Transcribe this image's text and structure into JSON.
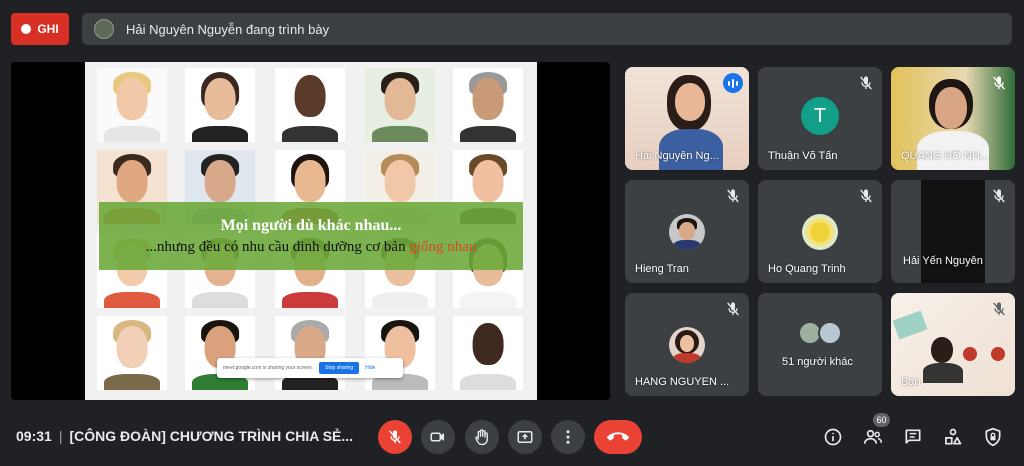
{
  "top_bar": {
    "record_label": "GHI",
    "presenting_text": "Hải Nguyên Nguyễn đang trình bày"
  },
  "slide": {
    "line1": "Mọi người dù khác nhau...",
    "line2_prefix": "...nhưng đều có nhu cầu dinh dưỡng cơ bản ",
    "line2_highlight": "giống nhau",
    "share_notice": "meet.google.com is sharing your screen.",
    "stop_sharing": "Stop sharing",
    "hide": "Hide"
  },
  "participants": [
    {
      "name": "Hải Nguyên Ng..."
    },
    {
      "name": "Thuận Võ Tấn",
      "initial": "T"
    },
    {
      "name": "QUANG HỒ NH..."
    },
    {
      "name": "Hieng Tran"
    },
    {
      "name": "Ho Quang Trinh"
    },
    {
      "name": "Hải Yến Nguyễn"
    },
    {
      "name": "HANG NGUYEN ..."
    },
    {
      "name": "51 người khác"
    },
    {
      "name": "Bạn"
    }
  ],
  "bottom_bar": {
    "time": "09:31",
    "separator": "|",
    "meeting_title": "[CÔNG ĐOÀN] CHƯƠNG TRÌNH CHIA SẺ...",
    "people_count": "60"
  },
  "colors": {
    "background": "#202124",
    "tile": "#3c4043",
    "danger": "#ea4335",
    "accent": "#1a73e8",
    "banner": "#6eaa3c",
    "highlight_text": "#d9481e"
  },
  "icons": {
    "mic": "mic-off-icon",
    "camera": "camera-icon",
    "hand": "raise-hand-icon",
    "present": "present-screen-icon",
    "more": "more-vert-icon",
    "hangup": "hangup-icon",
    "info": "info-icon",
    "people": "people-icon",
    "chat": "chat-icon",
    "activities": "activities-icon",
    "host": "host-controls-icon"
  }
}
